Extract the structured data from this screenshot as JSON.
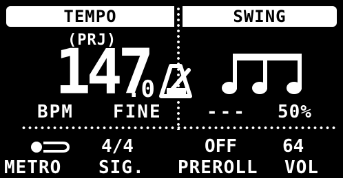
{
  "header": {
    "tempo_label": "TEMPO",
    "swing_label": "SWING"
  },
  "tempo": {
    "mode_label": "(PRJ)",
    "bpm_integer": "147",
    "bpm_fine_digit": ".0",
    "bpm_label": "BPM",
    "fine_label": "FINE"
  },
  "swing": {
    "value_left": "---",
    "value_right": "50%",
    "icon": "triplet-notes-icon"
  },
  "metronome_icon": "metronome-icon",
  "params": [
    {
      "label": "METRO",
      "value_icon": "toggle-icon",
      "enabled": true
    },
    {
      "label": "SIG.",
      "value": "4/4"
    },
    {
      "label": "PREROLL",
      "value": "OFF"
    },
    {
      "label": "VOL",
      "value": "64"
    }
  ],
  "colors": {
    "background": "#000000",
    "foreground": "#ffffff"
  }
}
